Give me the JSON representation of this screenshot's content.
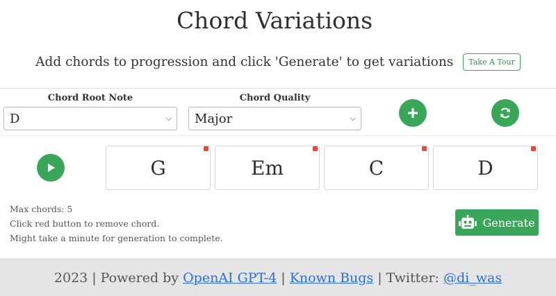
{
  "header": {
    "title": "Chord Variations",
    "subtitle": "Add chords to progression and click 'Generate' to get variations",
    "tour_button": "Take A Tour"
  },
  "controls": {
    "root_label": "Chord Root Note",
    "root_value": "D",
    "quality_label": "Chord Quality",
    "quality_value": "Major",
    "add_icon": "plus-icon",
    "refresh_icon": "refresh-icon",
    "play_icon": "play-icon"
  },
  "progression": {
    "chords": [
      "G",
      "Em",
      "C",
      "D"
    ]
  },
  "info": {
    "max": "Max chords: 5",
    "remove_hint": "Click red button to remove chord.",
    "wait_hint": "Might take a minute for generation to complete."
  },
  "generate": {
    "label": "Generate",
    "icon": "robot-icon"
  },
  "footer": {
    "year": "2023",
    "powered_prefix": "Powered by",
    "powered_link": "OpenAI GPT-4",
    "bugs_link": "Known Bugs",
    "twitter_prefix": "Twitter:",
    "twitter_link": "@di_was"
  },
  "colors": {
    "accent": "#3aa65a",
    "remove": "#e8473b",
    "link": "#2a6fdb",
    "footer_bg": "#e5e5e5"
  }
}
